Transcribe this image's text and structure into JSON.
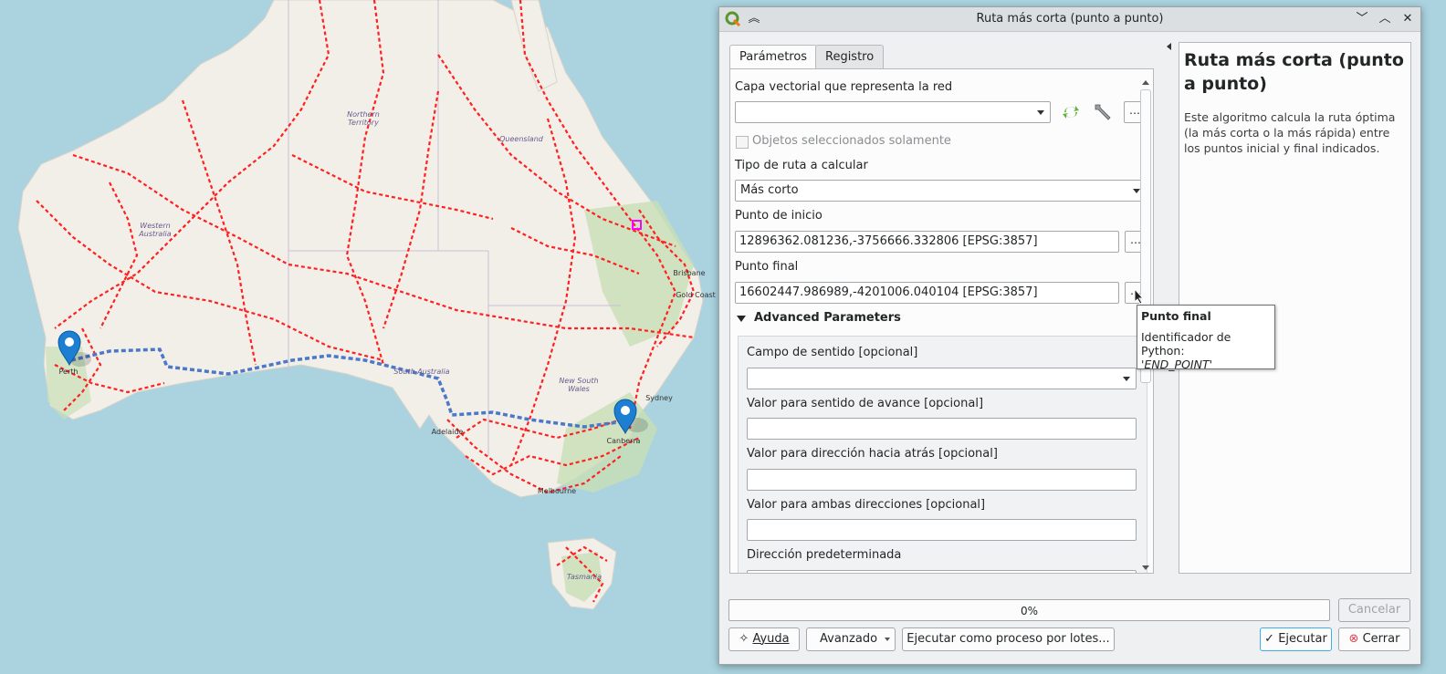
{
  "map": {
    "labels": {
      "northern_territory": [
        "Northern",
        "Territory"
      ],
      "queensland": "Queensland",
      "western_australia": [
        "Western",
        "Australia"
      ],
      "south_australia": "South Australia",
      "new_south_wales": [
        "New South",
        "Wales"
      ],
      "perth": "Perth",
      "adelaide": "Adelaide",
      "melbourne": "Melbourne",
      "canberra": "Canberra",
      "sydney": "Sydney",
      "brisbane": "Brisbane",
      "gold_coast": "Gold Coast",
      "tasmania": "Tasmania"
    },
    "colors": {
      "sea": "#aad3df",
      "land": "#f2efe9",
      "roads": "#ff2020",
      "route": "#4c78c9",
      "marker": "#1d7fd1"
    }
  },
  "dialog": {
    "title": "Ruta más corta (punto a punto)",
    "tabs": {
      "parameters": "Parámetros",
      "log": "Registro"
    },
    "params": {
      "network_label": "Capa vectorial que representa la red",
      "network_value": "",
      "selected_only": "Objetos seleccionados solamente",
      "route_type_label": "Tipo de ruta a calcular",
      "route_type_value": "Más corto",
      "start_label": "Punto de inicio",
      "start_value": "12896362.081236,-3756666.332806 [EPSG:3857]",
      "end_label": "Punto final",
      "end_value": "16602447.986989,-4201006.040104 [EPSG:3857]",
      "advanced_header": "Advanced Parameters",
      "direction_field_label": "Campo de sentido [opcional]",
      "forward_label": "Valor para sentido de avance [opcional]",
      "backward_label": "Valor para dirección hacia atrás [opcional]",
      "both_label": "Valor para ambas direcciones [opcional]",
      "default_direction_label": "Dirección predeterminada"
    },
    "help": {
      "title": "Ruta más corta (punto a punto)",
      "text": "Este algoritmo calcula la ruta óptima (la más corta o la más rápida) entre los puntos inicial y final indicados."
    },
    "progress": "0%",
    "buttons": {
      "cancel": "Cancelar",
      "help": "Ayuda",
      "advanced": "Avanzado",
      "batch": "Ejecutar como proceso por lotes...",
      "run": "Ejecutar",
      "close": "Cerrar"
    },
    "tooltip": {
      "title": "Punto final",
      "body": "Identificador de Python:",
      "id": "'END_POINT'"
    }
  }
}
